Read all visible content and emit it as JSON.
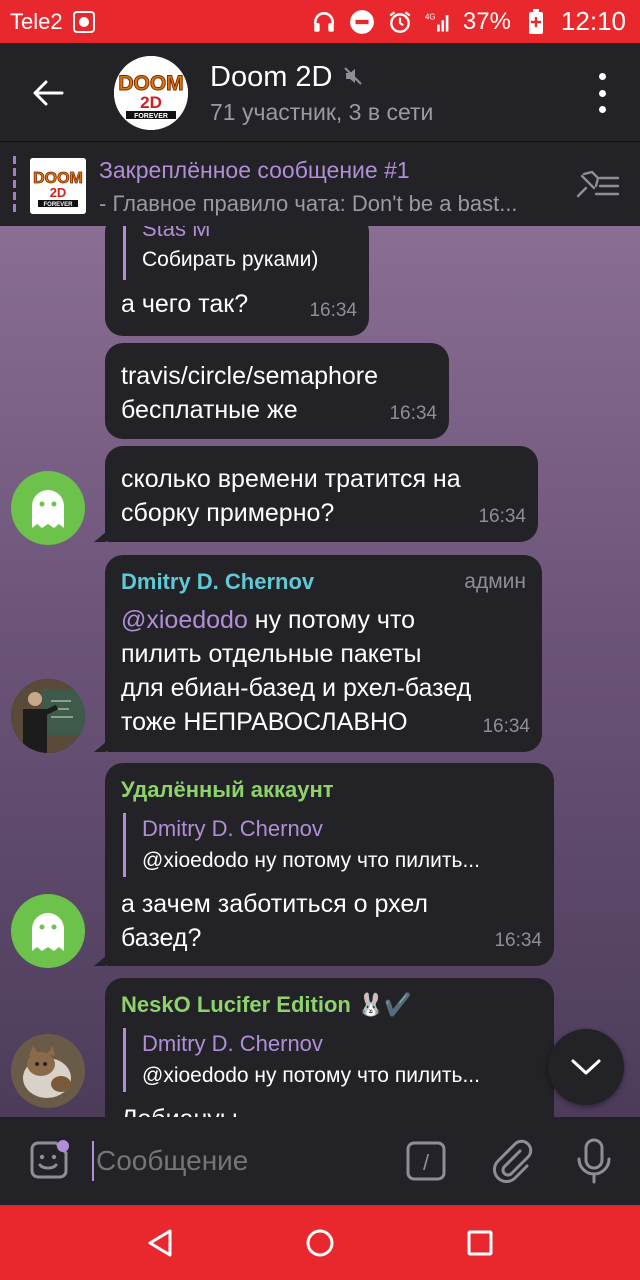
{
  "status_bar": {
    "carrier": "Tele2",
    "network": "4G",
    "battery": "37%",
    "time": "12:10"
  },
  "header": {
    "title": "Doom 2D",
    "subtitle": "71 участник, 3 в сети",
    "avatar_logo_top": "DOOM",
    "avatar_logo_mid": "2D",
    "avatar_logo_bottom": "FOREVER"
  },
  "pinned": {
    "title": "Закреплённое сообщение #1",
    "text": "- Главное правило чата: Don't be a bast..."
  },
  "messages": [
    {
      "reply_name": "Stas M",
      "reply_text": "Собирать руками)",
      "text": "а чего так?",
      "time": "16:34"
    },
    {
      "text_line1": "travis/circle/semaphore",
      "text_line2": "бесплатные же",
      "time": "16:34"
    },
    {
      "text_line1": "сколько времени тратится на",
      "text_line2": "сборку примерно?",
      "time": "16:34"
    },
    {
      "sender": "Dmitry D. Chernov",
      "badge": "админ",
      "mention": "@xioedodo",
      "line1": " ну потому что",
      "line2": "пилить отдельные пакеты",
      "line3": "для ебиан-базед и рхел-базед",
      "line4": "тоже НЕПРАВОСЛАВНО",
      "time": "16:34"
    },
    {
      "sender": "Удалённый аккаунт",
      "reply_name": "Dmitry D. Chernov",
      "reply_text": "@xioedodo ну потому что пилить...",
      "text_line1": "а зачем заботиться о рхел",
      "text_line2": "базед?",
      "time": "16:34"
    },
    {
      "sender": "NeskO Lucifer Edition",
      "sender_emoji": "🐰✔️",
      "reply_name": "Dmitry D. Chernov",
      "reply_text": "@xioedodo ну потому что пилить...",
      "text_partial": "Лобиануы"
    }
  ],
  "input": {
    "placeholder": "Сообщение",
    "command_symbol": "/"
  },
  "colors": {
    "status_bar": "#e8282c",
    "header_bg": "#232226",
    "bubble_bg": "#232226",
    "accent_purple": "#b08fd8",
    "admin_name": "#5fc9d6",
    "deleted_name": "#8ed26b",
    "nesko_name": "#8ed26b",
    "ghost_avatar": "#6cc24a"
  }
}
